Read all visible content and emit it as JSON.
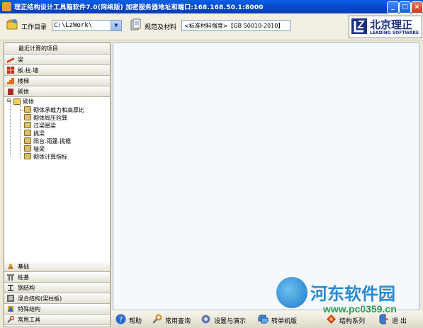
{
  "window": {
    "title": "理正结构设计工具箱软件7.0(网络版)  加密服务器地址和端口:168.168.50.1:8000",
    "min_label": "_",
    "max_label": "□",
    "close_label": "×"
  },
  "toolbar": {
    "workdir_label": "工作目录",
    "workdir_value": "C:\\LzWork\\",
    "spec_label": "规范及材料",
    "spec_value": "<标准材料强度>【GB 50010-2010】"
  },
  "logo": {
    "cn": "北京理正",
    "en": "LEADING SOFTWARE"
  },
  "sidebar": {
    "recent_label": "最近计算的项目",
    "top_groups": [
      {
        "label": "梁",
        "icon": "beam-icon"
      },
      {
        "label": "板.柱.墙",
        "icon": "slab-column-wall-icon"
      },
      {
        "label": "楼梯",
        "icon": "stairs-icon"
      },
      {
        "label": "砌体",
        "icon": "masonry-icon"
      }
    ],
    "tree": {
      "root": "砌体",
      "children": [
        "砌体承载力和高厚比",
        "砌体局压验算",
        "过梁圈梁",
        "挑梁",
        "阳台.雨篷.挑檐",
        "墙梁",
        "砌体计算指标"
      ]
    },
    "bottom_groups": [
      {
        "label": "基础",
        "icon": "foundation-icon"
      },
      {
        "label": "桩基",
        "icon": "pile-icon"
      },
      {
        "label": "钢结构",
        "icon": "steel-structure-icon"
      },
      {
        "label": "混合结构(梁柱板)",
        "icon": "mixed-structure-icon"
      },
      {
        "label": "特殊结构",
        "icon": "special-structure-icon"
      },
      {
        "label": "常用工具",
        "icon": "tools-icon"
      }
    ]
  },
  "bottombar": {
    "items": [
      {
        "label": "帮助",
        "icon": "help-icon"
      },
      {
        "label": "常用查询",
        "icon": "query-icon"
      },
      {
        "label": "设置与演示",
        "icon": "settings-icon"
      },
      {
        "label": "转单机版",
        "icon": "standalone-icon"
      },
      {
        "label": "结构系列",
        "icon": "structure-series-icon"
      },
      {
        "label": "退 出",
        "icon": "exit-icon"
      }
    ]
  },
  "watermark": {
    "text": "河东软件园",
    "url": "www.pc0359.cn"
  }
}
